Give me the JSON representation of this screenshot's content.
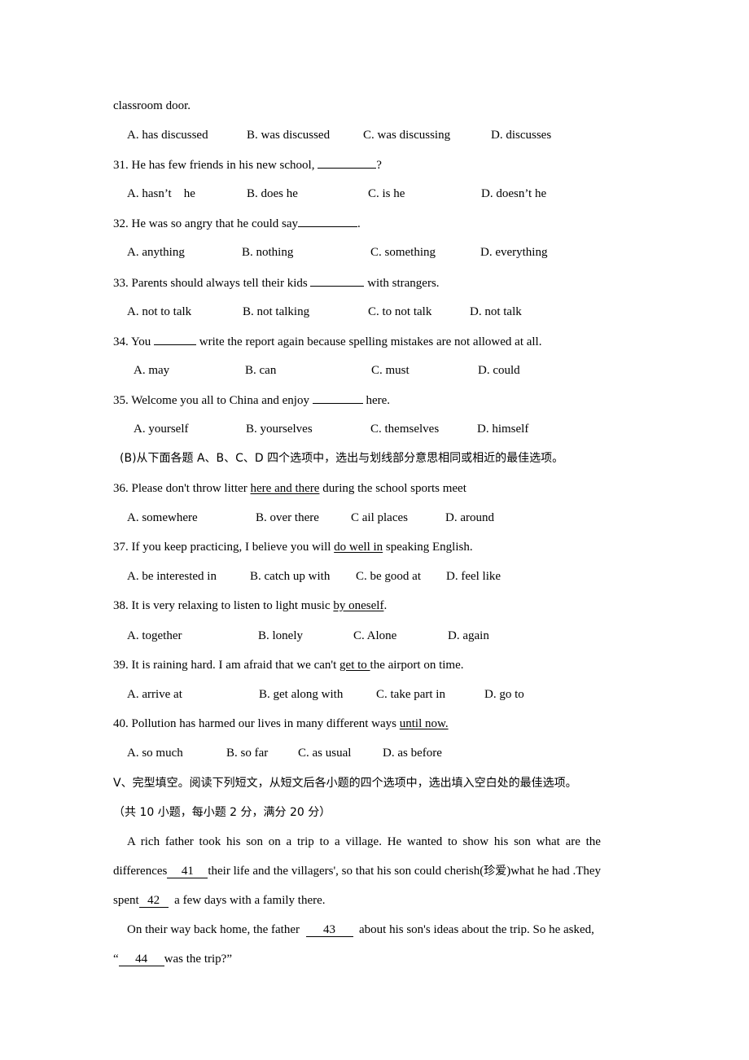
{
  "continuation": {
    "text": "classroom door."
  },
  "q30_options": [
    "A. has discussed",
    "B. was discussed",
    "C. was discussing",
    "D. discusses"
  ],
  "questions": [
    {
      "number": "31.",
      "before": "He has few friends in his new school, ",
      "after": "?",
      "options": [
        "A. hasn’t    he",
        "B. does he",
        "C. is he",
        "D. doesn’t he"
      ]
    },
    {
      "number": "32.",
      "before": "He was so angry that he could say",
      "after": ".",
      "options": [
        "A. anything",
        "B. nothing",
        "C. something",
        "D. everything"
      ]
    },
    {
      "number": "33.",
      "before": "Parents should always tell their kids ",
      "after": " with strangers.",
      "options": [
        "A. not to talk",
        "B. not talking",
        "C. to not talk",
        "D. not talk"
      ]
    },
    {
      "number": "34.",
      "before": "You ",
      "after": " write the report again because spelling mistakes are not allowed at all.",
      "options": [
        "A. may",
        "B. can",
        "C. must",
        "D. could"
      ]
    },
    {
      "number": "35.",
      "before": "Welcome you all to China and enjoy ",
      "after": " here.",
      "options": [
        "A. yourself",
        "B. yourselves",
        "C. themselves",
        "D. himself"
      ]
    }
  ],
  "section_b": {
    "instruction": "(B)从下面各题 A、B、C、D 四个选项中，选出与划线部分意思相同或相近的最佳选项。"
  },
  "synonym_questions": [
    {
      "number": "36.",
      "before": "Please don't throw litter ",
      "underlined": "here and there",
      "after": " during the school sports meet",
      "options": [
        "A. somewhere",
        "B. over there",
        "C ail places",
        "D. around"
      ]
    },
    {
      "number": "37.",
      "before": "If you keep practicing, I believe you will ",
      "underlined": "do well in",
      "after": " speaking English.",
      "options": [
        "A. be interested in",
        "B. catch up with",
        "C. be good at",
        "D. feel like"
      ]
    },
    {
      "number": "38.",
      "before": "It is very relaxing to listen to light music ",
      "underlined": "by oneself",
      "after": ".",
      "options": [
        "A. together",
        "B. lonely",
        "C. Alone",
        "D. again"
      ]
    },
    {
      "number": "39.",
      "before": "It is raining hard. I am afraid that we can't ",
      "underlined": "get to ",
      "after": "the airport on time.",
      "options": [
        "A. arrive at",
        "B. get along with",
        "C. take part in",
        "D. go to"
      ]
    },
    {
      "number": "40.",
      "before": "Pollution has harmed our lives in many different ways ",
      "underlined": "until now.",
      "after": "",
      "options": [
        "A. so much",
        "B. so far",
        "C. as usual",
        "D. as before"
      ]
    }
  ],
  "section_v": {
    "heading": "V、完型填空。阅读下列短文，从短文后各小题的四个选项中，选出填入空白处的最佳选项。",
    "scoring": "（共 10 小题，每小题 2 分，满分 20 分）"
  },
  "passage": {
    "p1_line1": "A rich father took his son on a trip to a village. He wanted to show his son what are the",
    "p1_line2_before": "differences",
    "blank41": "41",
    "p1_line2_mid": "their life and the villagers', so that his son could cherish(",
    "p1_line2_cjk": "珍爱",
    "p1_line2_after": ")what he had .They",
    "p1_line3_before": "spent",
    "blank42": "42",
    "p1_line3_after": "  a few days with a family there.",
    "p2_line1_before": "On their way back home, the father  ",
    "blank43": "43",
    "p2_line1_after": "  about his son's ideas about the trip. So he asked,",
    "p2_line2_before": "“",
    "blank44": "44",
    "p2_line2_after": "was the trip?”"
  }
}
